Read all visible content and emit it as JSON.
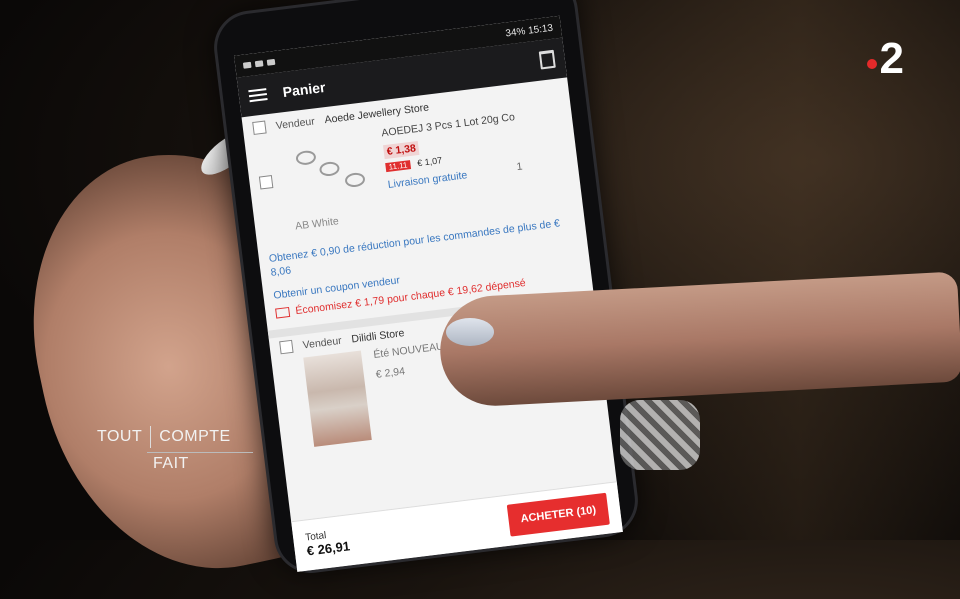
{
  "broadcast": {
    "channel_logo_digit": "2",
    "show_logo": {
      "line1_left": "TOUT",
      "line1_right": "COMPTE",
      "line2": "FAIT"
    }
  },
  "status_bar": {
    "battery": "34%",
    "time": "15:13"
  },
  "app_bar": {
    "title": "Panier"
  },
  "store1": {
    "vendor_label": "Vendeur",
    "vendor_name": "Aoede Jewellery Store",
    "item_title": "AOEDEJ 3 Pcs 1 Lot 20g Co",
    "price": "€ 1,38",
    "badge": "11.11",
    "badge_price": "€ 1,07",
    "shipping": "Livraison gratuite",
    "quantity": "1",
    "variant": "AB White",
    "promo": "Obtenez € 0,90 de réduction pour les commandes de plus de € 8,06",
    "coupon": "Obtenir un coupon vendeur",
    "save_note": "Économisez € 1,79 pour chaque € 19,62 dépensé"
  },
  "store2": {
    "vendor_label": "Vendeur",
    "vendor_name": "Dilidli Store",
    "item_title": "Été NOUVEAU Mode Femm",
    "price": "€ 2,94"
  },
  "footer": {
    "total_label": "Total",
    "total_value": "€ 26,91",
    "buy_label": "ACHETER (10)"
  },
  "colors": {
    "accent": "#e62e2e",
    "link": "#3a78c0",
    "app_bar": "#1b1b1d"
  }
}
